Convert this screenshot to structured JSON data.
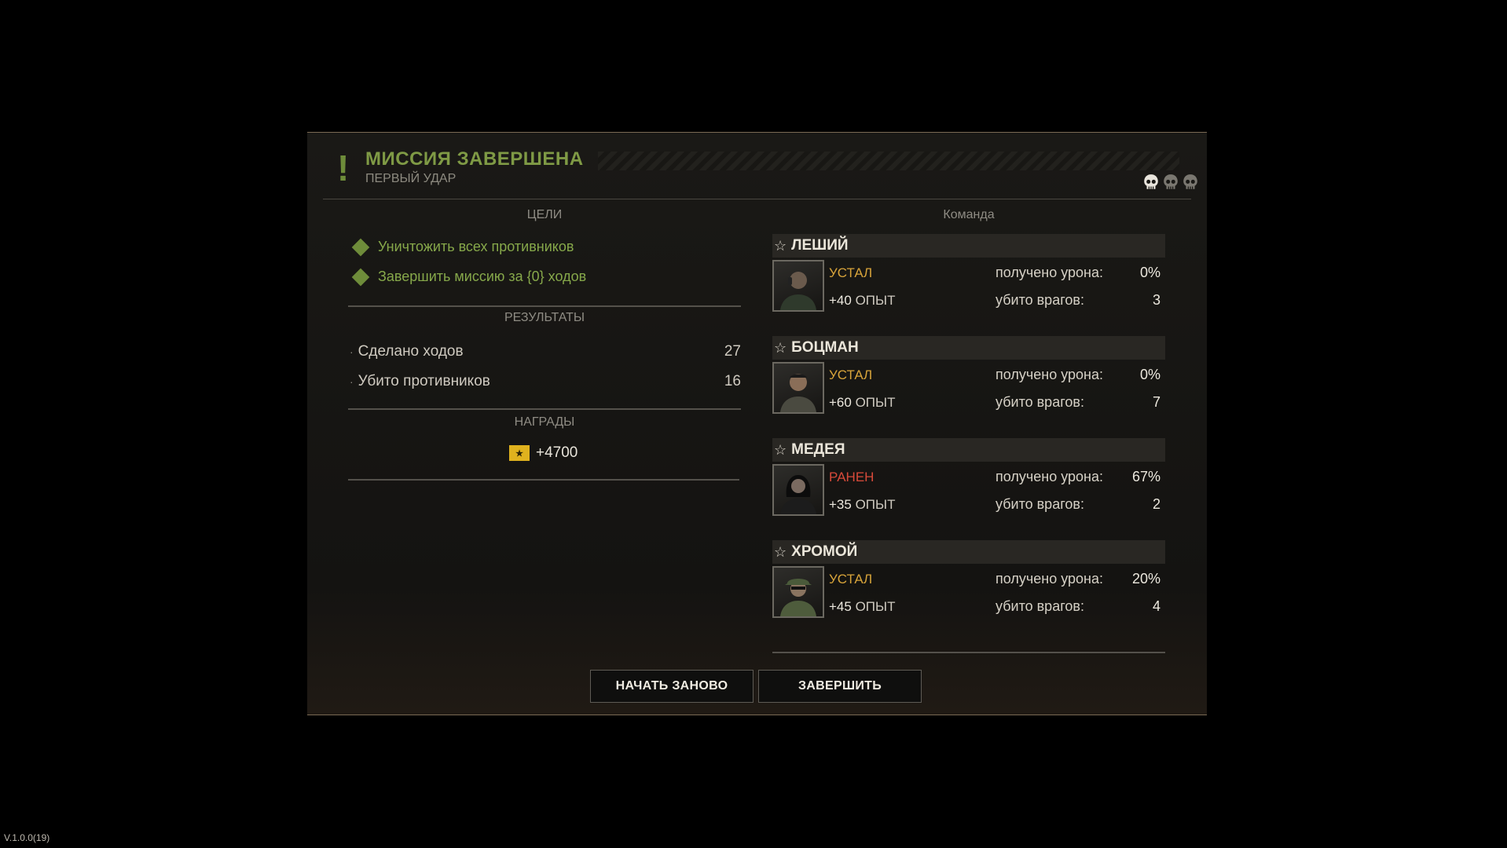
{
  "header": {
    "title": "МИССИЯ ЗАВЕРШЕНА",
    "subtitle": "ПЕРВЫЙ УДАР",
    "exclamation": "!",
    "skulls": [
      "skull-icon",
      "skull-icon",
      "skull-icon"
    ]
  },
  "objectives": {
    "title": "ЦЕЛИ",
    "items": [
      {
        "label": "Уничтожить всех противников",
        "icon": "diamond-icon"
      },
      {
        "label": "Завершить миссию за {0} ходов",
        "icon": "diamond-icon"
      }
    ]
  },
  "results": {
    "title": "РЕЗУЛЬТАТЫ",
    "bullet": "·",
    "rows": [
      {
        "label": "Сделано ходов",
        "value": "27"
      },
      {
        "label": "Убито противников",
        "value": "16"
      }
    ]
  },
  "rewards": {
    "title": "НАГРАДЫ",
    "amount": "+4700",
    "icon": "money-icon"
  },
  "team": {
    "title": "Команда",
    "damage_label": "получено урона:",
    "kills_label": "убито врагов:",
    "xp_suffix": "ОПЫТ",
    "members": [
      {
        "name": "ЛЕШИЙ",
        "status": "УСТАЛ",
        "status_color": "#d8a43a",
        "xp": "+40",
        "damage": "0%",
        "kills": "3"
      },
      {
        "name": "БОЦМАН",
        "status": "УСТАЛ",
        "status_color": "#d8a43a",
        "xp": "+60",
        "damage": "0%",
        "kills": "7"
      },
      {
        "name": "МЕДЕЯ",
        "status": "РАНЕН",
        "status_color": "#d84a3a",
        "xp": "+35",
        "damage": "67%",
        "kills": "2"
      },
      {
        "name": "ХРОМОЙ",
        "status": "УСТАЛ",
        "status_color": "#d8a43a",
        "xp": "+45",
        "damage": "20%",
        "kills": "4"
      }
    ]
  },
  "buttons": {
    "restart": "НАЧАТЬ ЗАНОВО",
    "finish": "ЗАВЕРШИТЬ"
  },
  "version": "V.1.0.0(19)",
  "colors": {
    "accent_green": "#7f9a45",
    "status_tired": "#d8a43a",
    "status_wounded": "#d84a3a"
  }
}
